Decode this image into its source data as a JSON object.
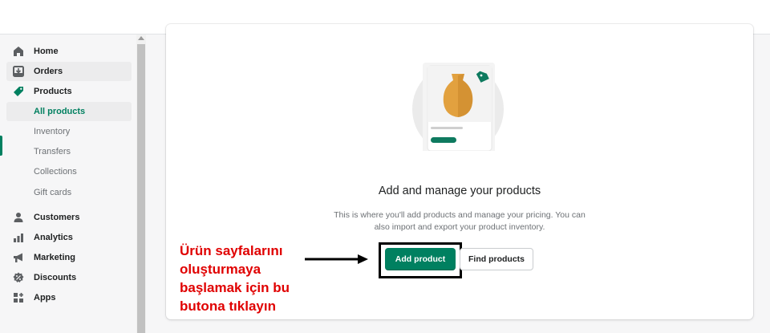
{
  "sidebar": {
    "items": [
      {
        "label": "Home",
        "icon": "home-icon"
      },
      {
        "label": "Orders",
        "icon": "orders-icon"
      },
      {
        "label": "Products",
        "icon": "tag-icon"
      },
      {
        "label": "Customers",
        "icon": "person-icon"
      },
      {
        "label": "Analytics",
        "icon": "bar-chart-icon"
      },
      {
        "label": "Marketing",
        "icon": "megaphone-icon"
      },
      {
        "label": "Discounts",
        "icon": "discount-icon"
      },
      {
        "label": "Apps",
        "icon": "apps-icon"
      }
    ],
    "sub_items": [
      {
        "label": "All products",
        "active": true
      },
      {
        "label": "Inventory"
      },
      {
        "label": "Transfers"
      },
      {
        "label": "Collections"
      },
      {
        "label": "Gift cards"
      }
    ]
  },
  "empty_state": {
    "heading": "Add and manage your products",
    "description": "This is where you'll add products and manage your pricing. You can also import and export your product inventory.",
    "primary_label": "Add product",
    "secondary_label": "Find products"
  },
  "annotation": {
    "lines": [
      "Ürün sayfalarını",
      "oluşturmaya",
      "başlamak için bu",
      "butona tıklayın"
    ]
  },
  "colors": {
    "accent": "#008060",
    "annotation": "#e00000"
  }
}
